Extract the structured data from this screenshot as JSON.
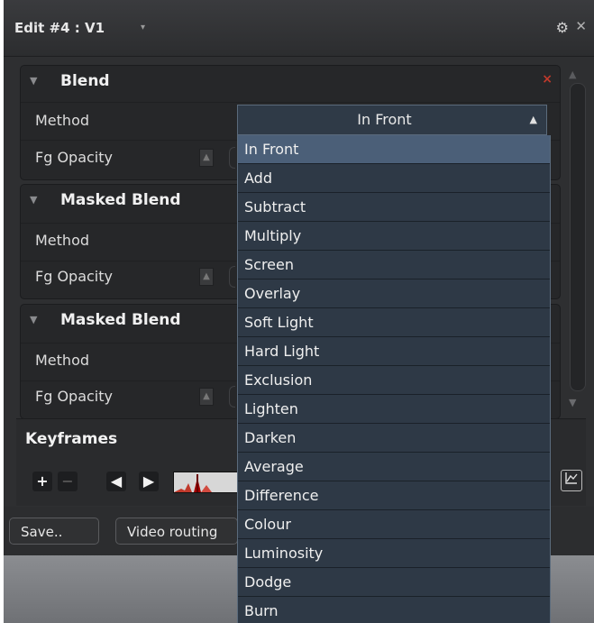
{
  "window": {
    "title": "Edit #4 : V1",
    "title_arrow": "▾",
    "gear_glyph": "⚙",
    "close_glyph": "✕"
  },
  "sections": [
    {
      "title": "Blend",
      "remove": "×",
      "rows": [
        {
          "label": "Method"
        },
        {
          "label": "Fg Opacity"
        }
      ]
    },
    {
      "title": "Masked Blend",
      "rows": [
        {
          "label": "Method"
        },
        {
          "label": "Fg Opacity"
        }
      ]
    },
    {
      "title": "Masked Blend",
      "rows": [
        {
          "label": "Method"
        },
        {
          "label": "Fg Opacity"
        }
      ]
    }
  ],
  "keyframes": {
    "title": "Keyframes",
    "add": "+",
    "remove": "−",
    "prev": "◀",
    "next": "▶"
  },
  "buttons": {
    "save": "Save..",
    "video_routing": "Video routing"
  },
  "dropdown": {
    "selected": "In Front",
    "arrow": "▲",
    "options": [
      "In Front",
      "Add",
      "Subtract",
      "Multiply",
      "Screen",
      "Overlay",
      "Soft Light",
      "Hard Light",
      "Exclusion",
      "Lighten",
      "Darken",
      "Average",
      "Difference",
      "Colour",
      "Luminosity",
      "Dodge",
      "Burn"
    ]
  },
  "colors": {
    "accent": "#4b5f78",
    "remove": "#c0392b",
    "panel": "#262729"
  }
}
